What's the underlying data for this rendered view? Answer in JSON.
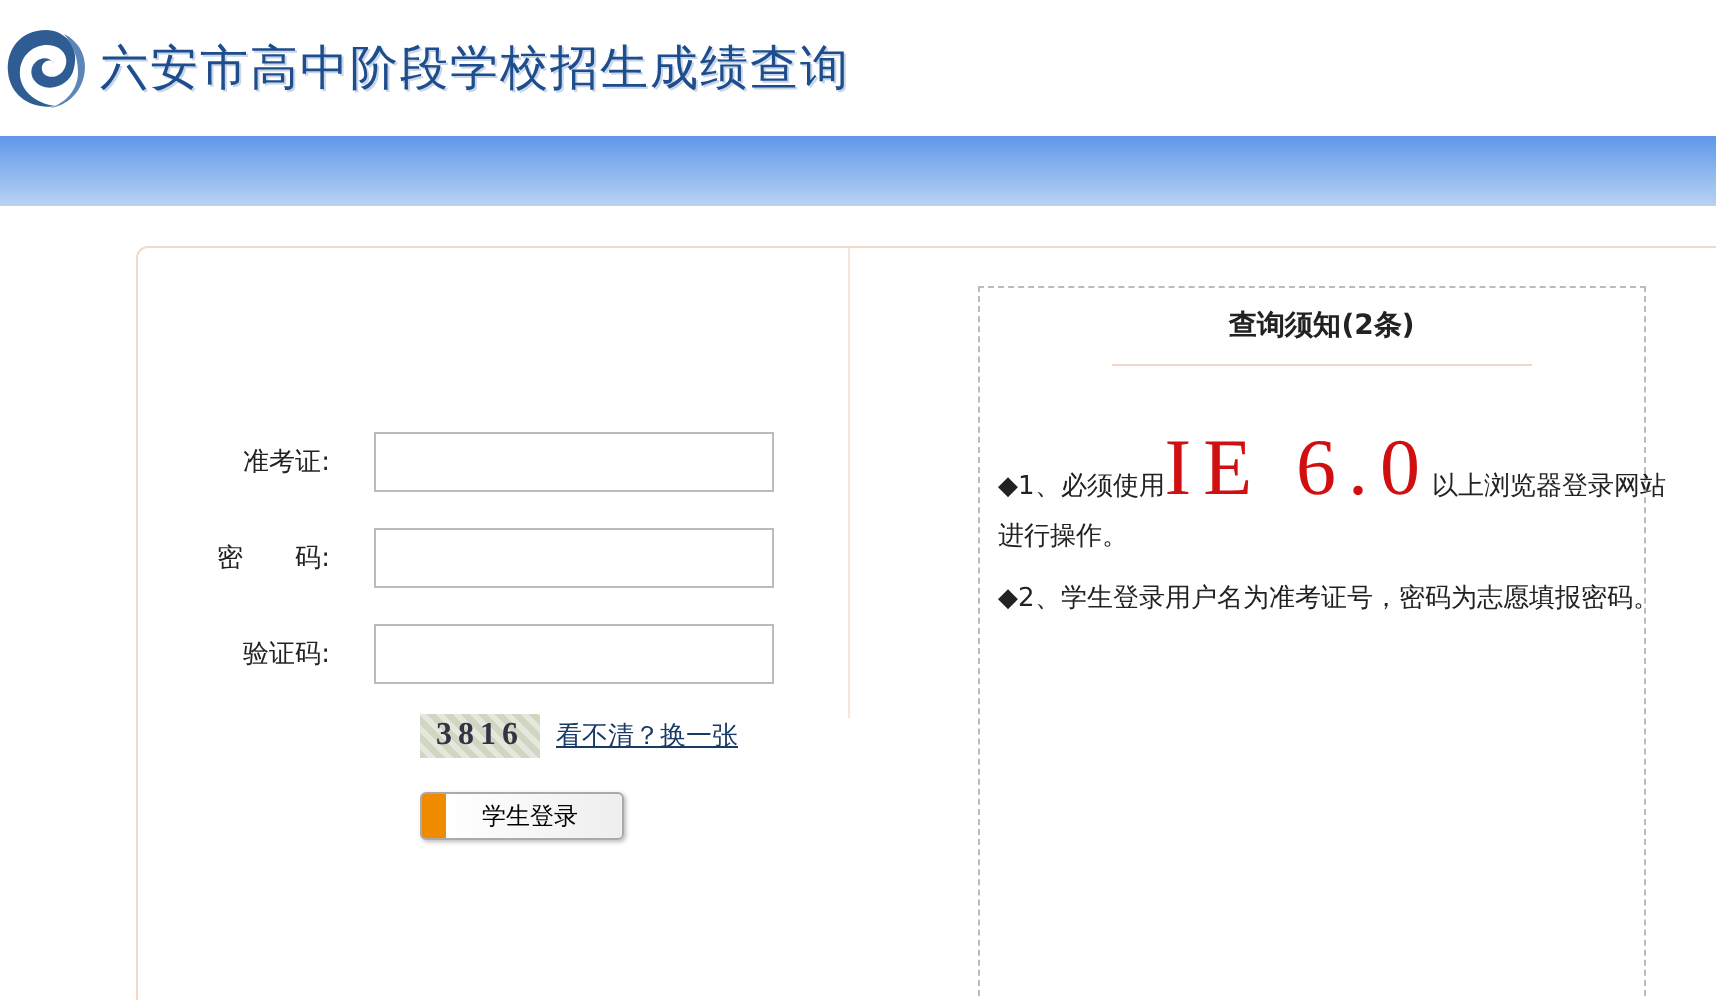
{
  "header": {
    "title": "六安市高中阶段学校招生成绩查询"
  },
  "login": {
    "fields": [
      {
        "label": "准考证:"
      },
      {
        "label": "密　　码:"
      },
      {
        "label": "验证码:"
      }
    ],
    "captcha": "3816",
    "refresh_link": "看不清？换一张",
    "submit": "学生登录"
  },
  "notice": {
    "title": "查询须知(2条)",
    "items": [
      {
        "before": "◆1、必须使用",
        "highlight": "IE 6.0",
        "after": "以上浏览器登录网站进行操作。"
      },
      {
        "before": "◆2、学生登录用户名为准考证号，密码为志愿填报密码。"
      }
    ]
  }
}
